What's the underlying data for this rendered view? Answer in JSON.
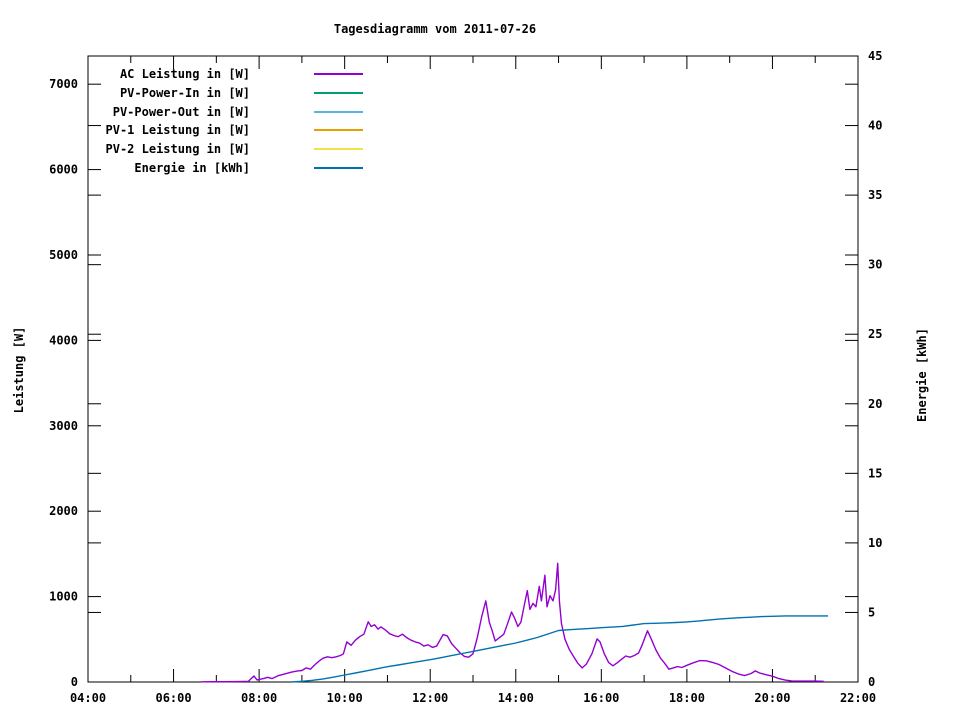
{
  "chart_data": {
    "type": "line",
    "title": "Tagesdiagramm vom 2011-07-26",
    "ylabel_left": "Leistung [W]",
    "ylabel_right": "Energie [kWh]",
    "grid": false,
    "legend_position": "inside-top-left",
    "x_axis": {
      "start_hour": 4,
      "end_hour": 22,
      "major_tick_every_hours": 2,
      "minor_tick_every_hours": 1,
      "tick_labels": [
        "04:00",
        "06:00",
        "08:00",
        "10:00",
        "12:00",
        "14:00",
        "16:00",
        "18:00",
        "20:00",
        "22:00"
      ]
    },
    "y_left": {
      "min": 0,
      "max": 7330,
      "tick_step": 1000,
      "tick_labels": [
        "0",
        "1000",
        "2000",
        "3000",
        "4000",
        "5000",
        "6000",
        "7000"
      ]
    },
    "y_right": {
      "min": 0,
      "max": 45,
      "tick_step": 5,
      "tick_labels": [
        "0",
        "5",
        "10",
        "15",
        "20",
        "25",
        "30",
        "35",
        "40",
        "45"
      ]
    },
    "series": [
      {
        "label": "AC Leistung in [W]",
        "color": "#9400d3",
        "axis": "left",
        "points": [
          [
            6.65,
            2
          ],
          [
            6.9,
            3
          ],
          [
            7.2,
            3
          ],
          [
            7.5,
            5
          ],
          [
            7.75,
            8
          ],
          [
            7.88,
            70
          ],
          [
            7.95,
            25
          ],
          [
            8.1,
            40
          ],
          [
            8.2,
            55
          ],
          [
            8.3,
            40
          ],
          [
            8.45,
            75
          ],
          [
            8.6,
            95
          ],
          [
            8.75,
            115
          ],
          [
            8.9,
            130
          ],
          [
            9.0,
            135
          ],
          [
            9.1,
            165
          ],
          [
            9.2,
            150
          ],
          [
            9.3,
            200
          ],
          [
            9.4,
            245
          ],
          [
            9.5,
            280
          ],
          [
            9.6,
            295
          ],
          [
            9.7,
            285
          ],
          [
            9.8,
            295
          ],
          [
            9.9,
            310
          ],
          [
            9.97,
            330
          ],
          [
            10.05,
            470
          ],
          [
            10.15,
            430
          ],
          [
            10.25,
            490
          ],
          [
            10.35,
            530
          ],
          [
            10.45,
            560
          ],
          [
            10.55,
            705
          ],
          [
            10.62,
            650
          ],
          [
            10.7,
            670
          ],
          [
            10.78,
            620
          ],
          [
            10.85,
            645
          ],
          [
            10.95,
            610
          ],
          [
            11.05,
            565
          ],
          [
            11.15,
            545
          ],
          [
            11.25,
            530
          ],
          [
            11.35,
            560
          ],
          [
            11.45,
            520
          ],
          [
            11.55,
            490
          ],
          [
            11.65,
            470
          ],
          [
            11.75,
            455
          ],
          [
            11.85,
            420
          ],
          [
            11.95,
            435
          ],
          [
            12.05,
            405
          ],
          [
            12.15,
            420
          ],
          [
            12.3,
            555
          ],
          [
            12.4,
            540
          ],
          [
            12.5,
            450
          ],
          [
            12.6,
            395
          ],
          [
            12.7,
            340
          ],
          [
            12.8,
            300
          ],
          [
            12.9,
            290
          ],
          [
            13.0,
            330
          ],
          [
            13.1,
            520
          ],
          [
            13.2,
            760
          ],
          [
            13.3,
            950
          ],
          [
            13.38,
            700
          ],
          [
            13.45,
            600
          ],
          [
            13.52,
            480
          ],
          [
            13.62,
            520
          ],
          [
            13.72,
            560
          ],
          [
            13.82,
            700
          ],
          [
            13.9,
            820
          ],
          [
            13.97,
            750
          ],
          [
            14.05,
            650
          ],
          [
            14.12,
            700
          ],
          [
            14.2,
            900
          ],
          [
            14.27,
            1070
          ],
          [
            14.33,
            850
          ],
          [
            14.4,
            920
          ],
          [
            14.47,
            880
          ],
          [
            14.55,
            1120
          ],
          [
            14.6,
            950
          ],
          [
            14.68,
            1250
          ],
          [
            14.73,
            880
          ],
          [
            14.8,
            1010
          ],
          [
            14.87,
            950
          ],
          [
            14.93,
            1080
          ],
          [
            14.98,
            1390
          ],
          [
            15.02,
            950
          ],
          [
            15.07,
            680
          ],
          [
            15.15,
            500
          ],
          [
            15.25,
            380
          ],
          [
            15.35,
            300
          ],
          [
            15.45,
            220
          ],
          [
            15.55,
            165
          ],
          [
            15.65,
            210
          ],
          [
            15.78,
            330
          ],
          [
            15.9,
            505
          ],
          [
            15.97,
            470
          ],
          [
            16.07,
            330
          ],
          [
            16.17,
            230
          ],
          [
            16.27,
            190
          ],
          [
            16.37,
            225
          ],
          [
            16.47,
            265
          ],
          [
            16.57,
            305
          ],
          [
            16.67,
            290
          ],
          [
            16.77,
            310
          ],
          [
            16.87,
            340
          ],
          [
            16.95,
            430
          ],
          [
            17.08,
            600
          ],
          [
            17.17,
            500
          ],
          [
            17.27,
            380
          ],
          [
            17.38,
            280
          ],
          [
            17.48,
            220
          ],
          [
            17.58,
            150
          ],
          [
            17.68,
            165
          ],
          [
            17.78,
            180
          ],
          [
            17.88,
            170
          ],
          [
            18.0,
            195
          ],
          [
            18.15,
            225
          ],
          [
            18.3,
            250
          ],
          [
            18.45,
            248
          ],
          [
            18.6,
            230
          ],
          [
            18.75,
            205
          ],
          [
            18.9,
            165
          ],
          [
            19.05,
            125
          ],
          [
            19.2,
            95
          ],
          [
            19.35,
            75
          ],
          [
            19.5,
            100
          ],
          [
            19.6,
            130
          ],
          [
            19.7,
            105
          ],
          [
            19.85,
            85
          ],
          [
            20.0,
            68
          ],
          [
            20.15,
            40
          ],
          [
            20.3,
            22
          ],
          [
            20.45,
            12
          ],
          [
            20.7,
            10
          ],
          [
            21.0,
            10
          ],
          [
            21.2,
            8
          ]
        ]
      },
      {
        "label": "PV-Power-In in [W]",
        "color": "#009e73",
        "axis": "left",
        "points": []
      },
      {
        "label": "PV-Power-Out in [W]",
        "color": "#56b4e9",
        "axis": "left",
        "points": []
      },
      {
        "label": "PV-1 Leistung in [W]",
        "color": "#e69f00",
        "axis": "left",
        "points": []
      },
      {
        "label": "PV-2 Leistung in [W]",
        "color": "#f0e442",
        "axis": "left",
        "points": []
      },
      {
        "label": "Energie in [kWh]",
        "color": "#0072b2",
        "axis": "right",
        "points": [
          [
            8.75,
            0
          ],
          [
            9.0,
            0.05
          ],
          [
            9.25,
            0.12
          ],
          [
            9.5,
            0.22
          ],
          [
            9.75,
            0.35
          ],
          [
            10.0,
            0.5
          ],
          [
            10.25,
            0.65
          ],
          [
            10.5,
            0.8
          ],
          [
            10.75,
            0.95
          ],
          [
            11.0,
            1.1
          ],
          [
            11.25,
            1.22
          ],
          [
            11.5,
            1.35
          ],
          [
            11.75,
            1.48
          ],
          [
            12.0,
            1.6
          ],
          [
            12.25,
            1.75
          ],
          [
            12.5,
            1.9
          ],
          [
            12.75,
            2.05
          ],
          [
            13.0,
            2.2
          ],
          [
            13.25,
            2.35
          ],
          [
            13.5,
            2.5
          ],
          [
            13.75,
            2.65
          ],
          [
            14.0,
            2.8
          ],
          [
            14.25,
            3.0
          ],
          [
            14.5,
            3.2
          ],
          [
            14.75,
            3.45
          ],
          [
            15.0,
            3.7
          ],
          [
            15.25,
            3.76
          ],
          [
            15.5,
            3.8
          ],
          [
            15.75,
            3.85
          ],
          [
            16.0,
            3.9
          ],
          [
            16.25,
            3.95
          ],
          [
            16.5,
            4.0
          ],
          [
            16.75,
            4.1
          ],
          [
            17.0,
            4.2
          ],
          [
            17.25,
            4.22
          ],
          [
            17.5,
            4.25
          ],
          [
            17.75,
            4.28
          ],
          [
            18.0,
            4.32
          ],
          [
            18.25,
            4.38
          ],
          [
            18.5,
            4.45
          ],
          [
            18.75,
            4.52
          ],
          [
            19.0,
            4.58
          ],
          [
            19.25,
            4.62
          ],
          [
            19.5,
            4.66
          ],
          [
            19.75,
            4.7
          ],
          [
            20.0,
            4.72
          ],
          [
            20.3,
            4.75
          ],
          [
            20.7,
            4.75
          ],
          [
            21.0,
            4.75
          ],
          [
            21.3,
            4.75
          ]
        ]
      }
    ]
  }
}
